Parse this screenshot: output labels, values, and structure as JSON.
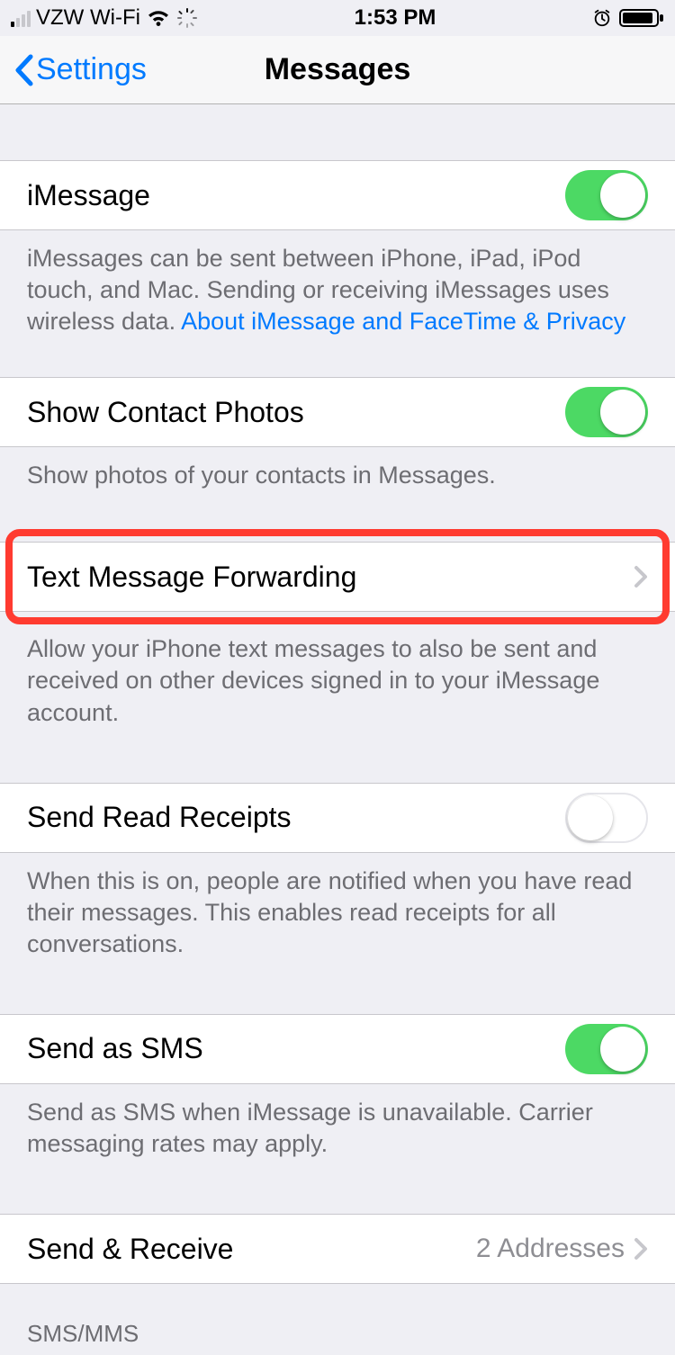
{
  "status": {
    "carrier": "VZW Wi-Fi",
    "time": "1:53 PM"
  },
  "nav": {
    "back_label": "Settings",
    "title": "Messages"
  },
  "rows": {
    "imessage": {
      "label": "iMessage",
      "on": true
    },
    "imessage_footer": "iMessages can be sent between iPhone, iPad, iPod touch, and Mac. Sending or receiving iMessages uses wireless data.",
    "imessage_link": "About iMessage and FaceTime & Privacy",
    "contact_photos": {
      "label": "Show Contact Photos",
      "on": true
    },
    "contact_photos_footer": "Show photos of your contacts in Messages.",
    "forwarding": {
      "label": "Text Message Forwarding"
    },
    "forwarding_footer": "Allow your iPhone text messages to also be sent and received on other devices signed in to your iMessage account.",
    "read_receipts": {
      "label": "Send Read Receipts",
      "on": false
    },
    "read_receipts_footer": "When this is on, people are notified when you have read their messages. This enables read receipts for all conversations.",
    "send_sms": {
      "label": "Send as SMS",
      "on": true
    },
    "send_sms_footer": "Send as SMS when iMessage is unavailable. Carrier messaging rates may apply.",
    "send_receive": {
      "label": "Send & Receive",
      "detail": "2 Addresses"
    }
  },
  "sections": {
    "sms_mms": "SMS/MMS"
  }
}
